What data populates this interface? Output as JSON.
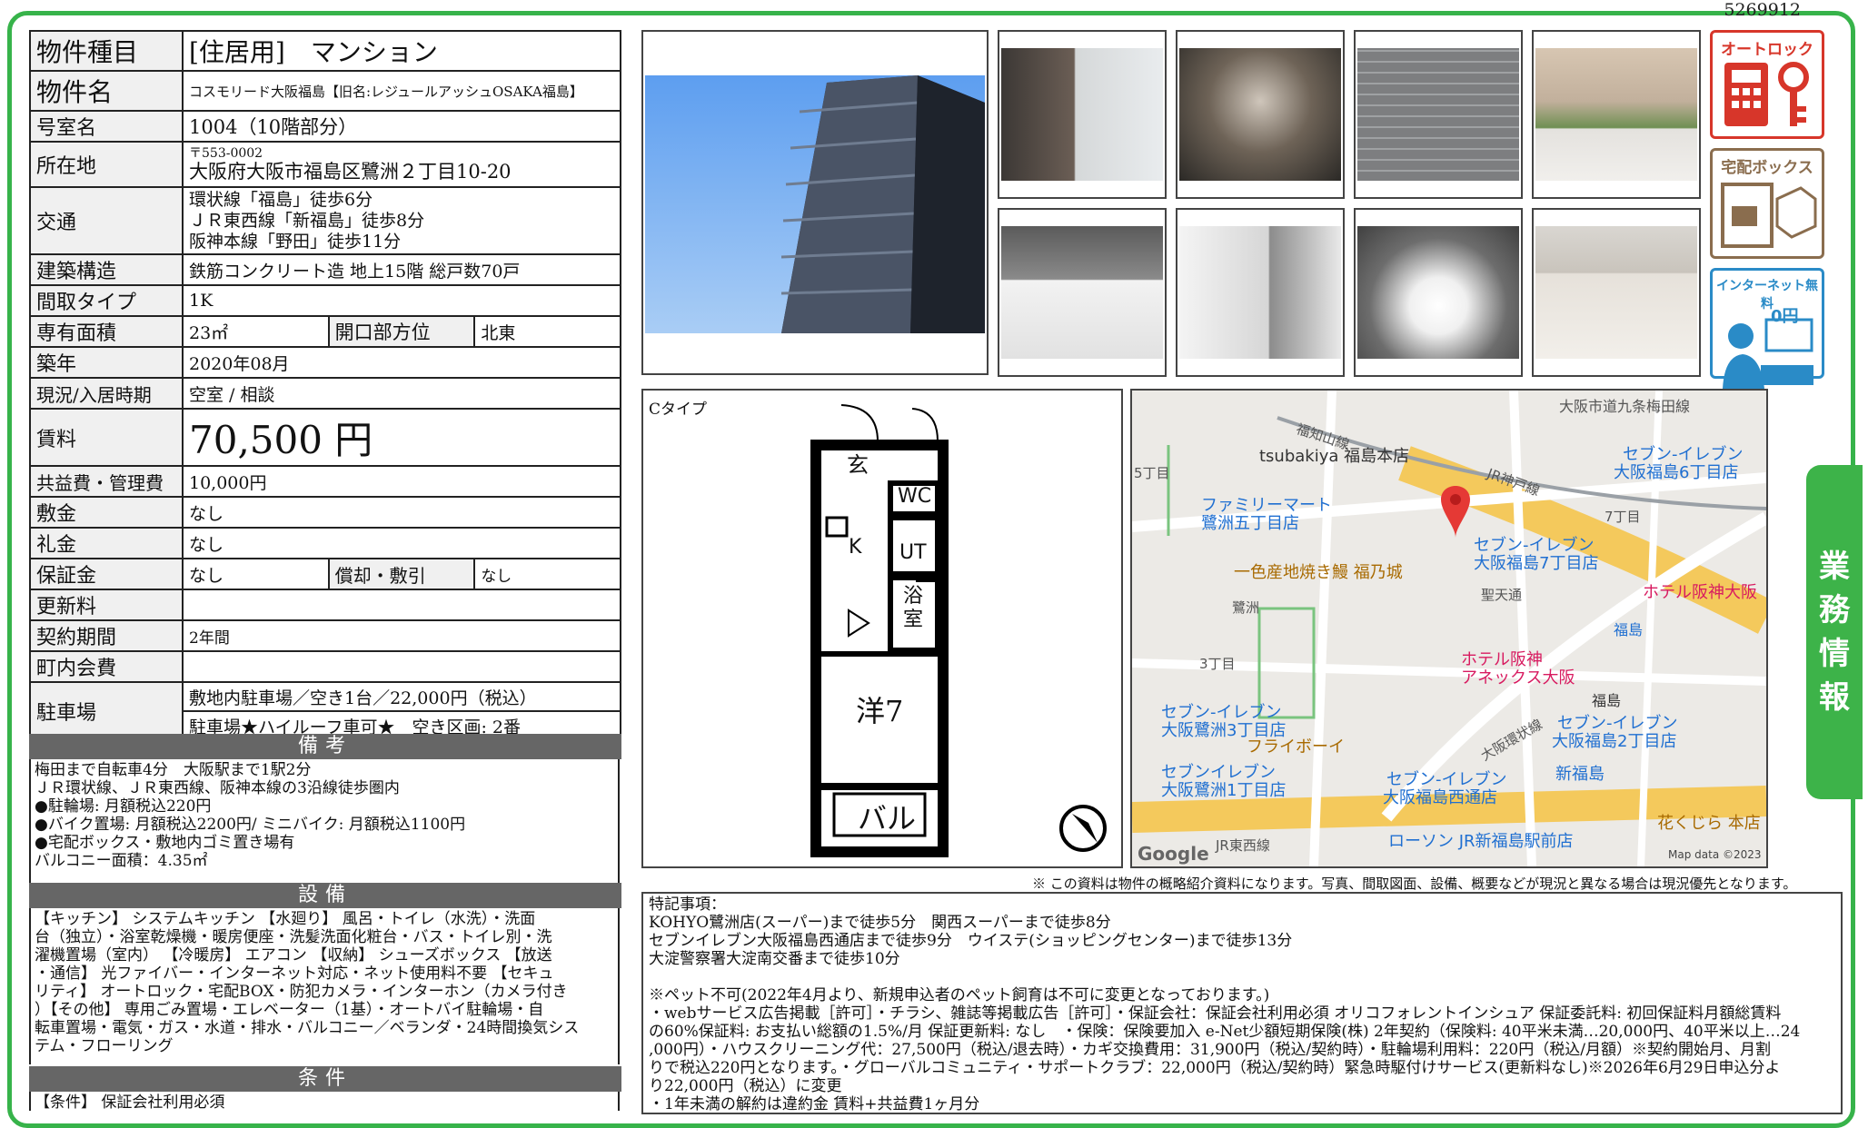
{
  "doc_id": "5269912",
  "side_tab": {
    "label": "業務情報"
  },
  "info": {
    "type_label": "物件種目",
    "type_value": "[住居用]　マンション",
    "name_label": "物件名",
    "name_value": "コスモリード大阪福島【旧名:レジュールアッシュOSAKA福島】",
    "room_label": "号室名",
    "room_value": "1004（10階部分）",
    "address_label": "所在地",
    "postal": "〒553-0002",
    "address": "大阪府大阪市福島区鷺洲２丁目10-20",
    "traffic_label": "交通",
    "traffic": [
      "環状線「福島」徒歩6分",
      "ＪＲ東西線「新福島」徒歩8分",
      "阪神本線「野田」徒歩11分"
    ],
    "structure_label": "建築構造",
    "structure_value": "鉄筋コンクリート造 地上15階 総戸数70戸",
    "layout_label": "間取タイプ",
    "layout_value": "1K",
    "area_label": "専有面積",
    "area_value": "23㎡",
    "direction_label": "開口部方位",
    "direction_value": "北東",
    "built_label": "築年",
    "built_value": "2020年08月",
    "status_label": "現況/入居時期",
    "status_value": "空室 /  相談",
    "rent_label": "賃料",
    "rent_value": "70,500 円",
    "fee_label": "共益費・管理費",
    "fee_value": "10,000円",
    "deposit_label": "敷金",
    "deposit_value": "なし",
    "key_label": "礼金",
    "key_value": "なし",
    "guarantee_label": "保証金",
    "guarantee_value": "なし",
    "amort_label": "償却・敷引",
    "amort_value": "なし",
    "renew_label": "更新料",
    "renew_value": "",
    "period_label": "契約期間",
    "period_value": "2年間",
    "town_label": "町内会費",
    "town_value": "",
    "parking_label": "駐車場",
    "parking_1": "敷地内駐車場／空き1台／22,000円（税込）",
    "parking_2": "駐車場★ハイルーフ車可★　空き区画: 2番"
  },
  "remarks": {
    "title": "備考",
    "lines": [
      "梅田まで自転車4分　大阪駅まで1駅2分",
      "ＪＲ環状線、ＪＲ東西線、阪神本線の3沿線徒歩圏内",
      "●駐輪場: 月額税込220円",
      "●バイク置場: 月額税込2200円/ ミニバイク: 月額税込1100円",
      "●宅配ボックス・敷地内ゴミ置き場有",
      "バルコニー面積：4.35㎡"
    ]
  },
  "equipment": {
    "title": "設備",
    "lines": [
      "【キッチン】 システムキッチン 【水廻り】 風呂・トイレ（水洗）・洗面",
      "台（独立）・浴室乾燥機・暖房便座・洗髪洗面化粧台・バス・トイレ別・洗",
      "濯機置場（室内） 【冷暖房】 エアコン 【収納】 シューズボックス 【放送",
      "・通信】 光ファイバー・インターネット対応・ネット使用料不要 【セキュ",
      "リティ】 オートロック・宅配BOX・防犯カメラ・インターホン（カメラ付き",
      "）【その他】 専用ごみ置場・エレベーター（1基）・オートバイ駐輪場・自",
      "転車置場・電気・ガス・水道・排水・バルコニー／ベランダ・24時間換気シス",
      "テム・フローリング"
    ]
  },
  "conditions": {
    "title": "条件",
    "lines": [
      "【条件】 保証会社利用必須"
    ]
  },
  "icons": {
    "autolock": "オートロック",
    "delivery": "宅配ボックス",
    "internet": "インターネット無料",
    "internet_price": "0円"
  },
  "floorplan": {
    "type_label": "Cタイプ",
    "genkan": "玄",
    "wc": "WC",
    "ut": "UT",
    "k": "K",
    "bath": "浴室",
    "room": "洋7",
    "balcony": "バル"
  },
  "map": {
    "labels": [
      "大阪市道九条梅田線",
      "福知山線",
      "tsubakiya 福島本店",
      "JR神戸線",
      "セブン-イレブン",
      "大阪福島6丁目店",
      "5丁目",
      "ファミリーマート",
      "鷺洲五丁目店",
      "7丁目",
      "セブン-イレブン",
      "大阪福島7丁目店",
      "一色産地焼き鰻 福乃城",
      "聖天通",
      "ホテル阪神大阪",
      "鷺洲",
      "福島",
      "ホテル阪神",
      "アネックス大阪",
      "3丁目",
      "福島",
      "セブン-イレブン",
      "大阪鷺洲3丁目店",
      "フライボーイ",
      "セブン-イレブン",
      "大阪福島2丁目店",
      "大阪環状線",
      "セブンイレブン",
      "大阪鷺洲1丁目店",
      "セブン-イレブン",
      "大阪福島西通店",
      "新福島",
      "花くじら 本店",
      "JR東西線",
      "ローソン JR新福島駅前店",
      "Google",
      "Map data ©2023"
    ]
  },
  "notice": "※ この資料は物件の概略紹介資料になります。写真、間取図面、設備、概要などが現況と異なる場合は現況優先となります。",
  "special": {
    "lines": [
      "特記事項：",
      "KOHYO鷺洲店(スーパー)まで徒歩5分　関西スーパーまで徒歩8分",
      "セブンイレブン大阪福島西通店まで徒歩9分　ウイステ(ショッピングセンター)まで徒歩13分",
      "大淀警察署大淀南交番まで徒歩10分",
      "",
      "※ペット不可(2022年4月より、新規申込者のペット飼育は不可に変更となっております。)",
      "・webサービス広告掲載［許可］・チラシ、雑誌等掲載広告［許可］・保証会社：保証会社利用必須 オリコフォレントインシュア 保証委託料: 初回保証料月額総賃料",
      "の60%保証料: お支払い総額の1.5%/月 保証更新料: なし　・保険：保険要加入 e-Net少額短期保険(株) 2年契約（保険料: 40平米未満…20,000円、40平米以上…24",
      ",000円）・ハウスクリーニング代：27,500円（税込/退去時）・カギ交換費用：31,900円（税込/契約時）・駐輪場利用料：220円（税込/月額）※契約開始月、月割",
      "りで税込220円となります。・グローバルコミュニティ・サポートクラブ：22,000円（税込/契約時）緊急時駆付けサービス(更新料なし)※2026年6月29日申込分よ",
      "り22,000円（税込）に変更",
      "・1年未満の解約は違約金 賃料+共益費1ヶ月分"
    ]
  }
}
